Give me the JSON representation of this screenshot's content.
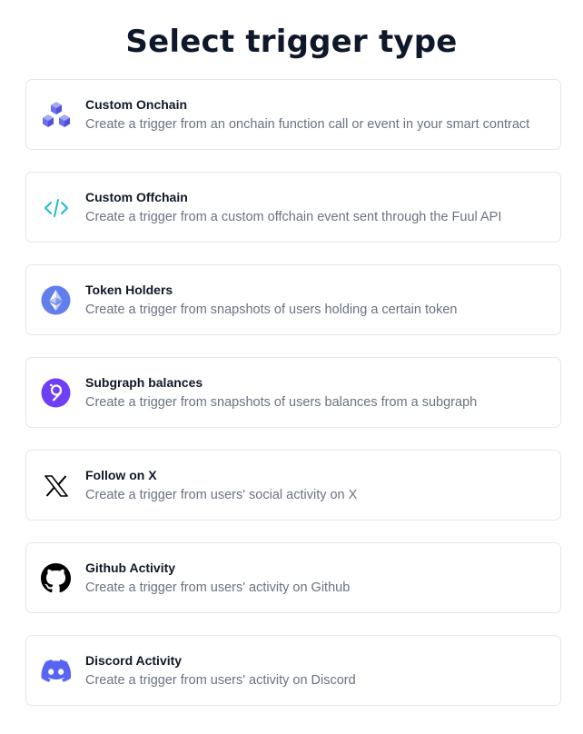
{
  "page": {
    "title": "Select trigger type"
  },
  "options": [
    {
      "title": "Custom Onchain",
      "description": "Create a trigger from an onchain function call or event in your smart contract",
      "icon": "cubes-icon",
      "icon_color": "#6b6ee8"
    },
    {
      "title": "Custom Offchain",
      "description": "Create a trigger from a custom offchain event sent through the Fuul API",
      "icon": "code-icon",
      "icon_color": "#22b8cf"
    },
    {
      "title": "Token Holders",
      "description": "Create a trigger from snapshots of users holding a certain token",
      "icon": "ethereum-icon",
      "icon_color": "#627eea"
    },
    {
      "title": "Subgraph balances",
      "description": "Create a trigger from snapshots of users balances from a subgraph",
      "icon": "graph-icon",
      "icon_color": "#6f3ff5"
    },
    {
      "title": "Follow on X",
      "description": "Create a trigger from users' social activity on X",
      "icon": "x-icon",
      "icon_color": "#000000"
    },
    {
      "title": "Github Activity",
      "description": "Create a trigger from users' activity on Github",
      "icon": "github-icon",
      "icon_color": "#000000"
    },
    {
      "title": "Discord Activity",
      "description": "Create a trigger from users' activity on Discord",
      "icon": "discord-icon",
      "icon_color": "#5865f2"
    }
  ]
}
